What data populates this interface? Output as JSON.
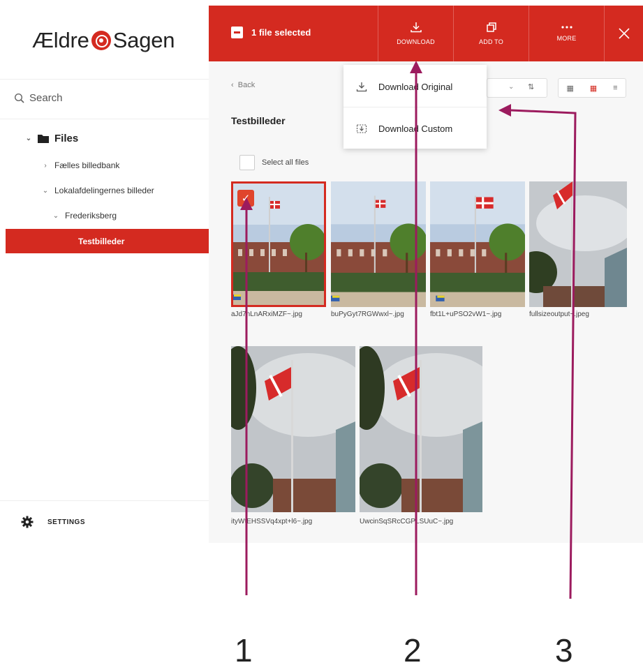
{
  "brand": {
    "logo_left": "Ældre",
    "logo_right": "Sagen",
    "accent": "#d42a20"
  },
  "sidebar": {
    "search_placeholder": "Search",
    "root": "Files",
    "items": [
      {
        "label": "Fælles billedbank"
      },
      {
        "label": "Lokalafdelingernes billeder"
      },
      {
        "label": "Frederiksberg"
      },
      {
        "label": "Testbilleder"
      }
    ],
    "settings_label": "SETTINGS"
  },
  "toolbar": {
    "selected_label": "1 file selected",
    "download_label": "DOWNLOAD",
    "addto_label": "ADD TO",
    "more_label": "MORE",
    "close_icon": "close-icon"
  },
  "main": {
    "back_label": "Back",
    "folder_title": "Testbilleder",
    "select_all_label": "Select all files",
    "files": [
      {
        "name": "aJd7nLnARxiMZF~.jpg",
        "selected": true
      },
      {
        "name": "buPyGyt7RGWwxl~.jpg",
        "selected": false
      },
      {
        "name": "fbt1L+uPSO2vW1~.jpg",
        "selected": false
      },
      {
        "name": "fullsizeoutput~.jpeg",
        "selected": false
      },
      {
        "name": "ityWtEHSSVq4xpt+l6~.jpg",
        "selected": false
      },
      {
        "name": "UwcinSqSRcCGPLSUuC~.jpg",
        "selected": false
      }
    ]
  },
  "download_menu": {
    "original_label": "Download Original",
    "custom_label": "Download Custom"
  },
  "annotations": {
    "one": "1",
    "two": "2",
    "three": "3"
  }
}
